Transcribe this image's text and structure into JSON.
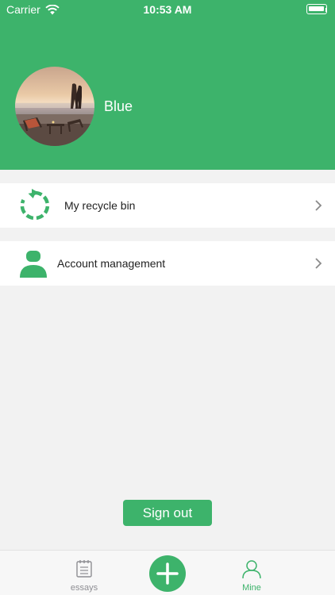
{
  "status_bar": {
    "carrier": "Carrier",
    "time": "10:53 AM"
  },
  "profile": {
    "username": "Blue"
  },
  "menu": {
    "items": [
      {
        "label": "My recycle bin",
        "icon": "recycle-icon"
      },
      {
        "label": "Account management",
        "icon": "person-icon"
      }
    ]
  },
  "actions": {
    "sign_out_label": "Sign out"
  },
  "tabbar": {
    "tabs": [
      {
        "label": "essays",
        "icon": "list-icon",
        "active": false
      },
      {
        "label": "",
        "icon": "plus-icon",
        "active": false
      },
      {
        "label": "Mine",
        "icon": "person-outline-icon",
        "active": true
      }
    ]
  },
  "colors": {
    "accent": "#3db36b",
    "background": "#f2f2f2",
    "inactive_tab": "#8e8e93"
  }
}
